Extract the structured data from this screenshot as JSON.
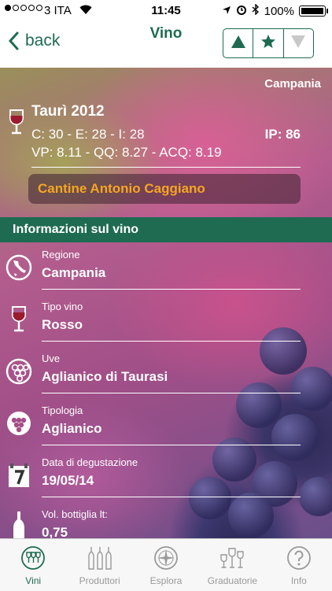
{
  "status_bar": {
    "carrier": "3 ITA",
    "time": "11:45",
    "battery": "100%"
  },
  "nav": {
    "back_label": "back",
    "title": "Vino"
  },
  "wine": {
    "region_top": "Campania",
    "name": "Taurì 2012",
    "scores_line1": "C: 30 - E: 28 - I: 28",
    "ip": "IP: 86",
    "scores_line2": "VP: 8.11 - QQ: 8.27 - ACQ: 8.19",
    "producer": "Cantine Antonio Caggiano"
  },
  "section_title": "Informazioni sul vino",
  "info_rows": [
    {
      "label": "Regione",
      "value": "Campania",
      "icon": "italy-map-icon"
    },
    {
      "label": "Tipo vino",
      "value": "Rosso",
      "icon": "wine-glass-icon"
    },
    {
      "label": "Uve",
      "value": "Aglianico di Taurasi",
      "icon": "grapes-icon"
    },
    {
      "label": "Tipologia",
      "value": "Aglianico",
      "icon": "grape-cluster-icon"
    },
    {
      "label": "Data di degustazione",
      "value": "19/05/14",
      "icon": "calendar-icon"
    },
    {
      "label": "Vol. bottiglia lt:",
      "value": "0,75",
      "icon": "bottle-icon"
    }
  ],
  "tabs": [
    {
      "label": "Vini",
      "icon": "wine-glasses-icon",
      "active": true
    },
    {
      "label": "Produttori",
      "icon": "bottles-icon",
      "active": false
    },
    {
      "label": "Esplora",
      "icon": "compass-icon",
      "active": false
    },
    {
      "label": "Graduatorie",
      "icon": "ranking-glasses-icon",
      "active": false
    },
    {
      "label": "Info",
      "icon": "help-icon",
      "active": false
    }
  ],
  "colors": {
    "accent": "#1e6b52",
    "producer_text": "#f5a623"
  }
}
